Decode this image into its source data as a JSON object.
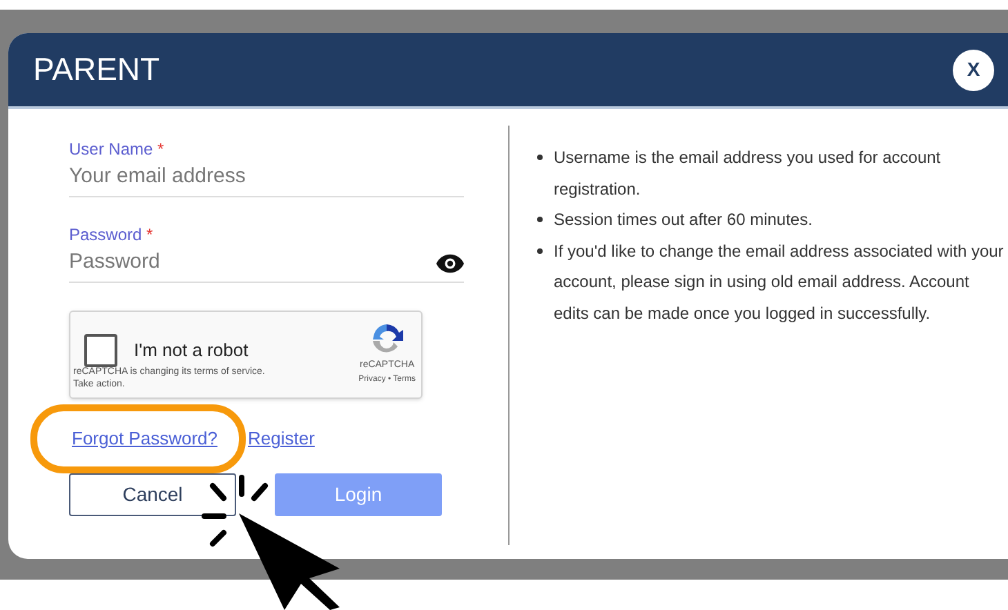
{
  "dialog": {
    "title": "PARENT",
    "close_label": "X"
  },
  "fields": [
    {
      "label": "User Name",
      "required_mark": "*",
      "placeholder": "Your email address",
      "kind": "text"
    },
    {
      "label": "Password",
      "required_mark": "*",
      "placeholder": "Password",
      "kind": "password"
    }
  ],
  "captcha": {
    "checked": false,
    "label": "I'm not a robot",
    "notice": "reCAPTCHA is changing its terms of service.",
    "notice_link": "Take action.",
    "brand": "reCAPTCHA",
    "links": "Privacy • Terms"
  },
  "links": [
    {
      "label": "Forgot Password?",
      "highlighted": true
    },
    {
      "label": "Register",
      "highlighted": false
    }
  ],
  "buttons": [
    {
      "label": "Cancel",
      "kind": "outline",
      "disabled": false
    },
    {
      "label": "Login",
      "kind": "primary",
      "disabled": true
    }
  ],
  "notes": [
    "Username is the email address you used for account registration.",
    "Session times out after 60 minutes.",
    "If you'd like to change the email address associated with your account, please sign in using old email address. Account edits can be made once you logged in successfully."
  ]
}
